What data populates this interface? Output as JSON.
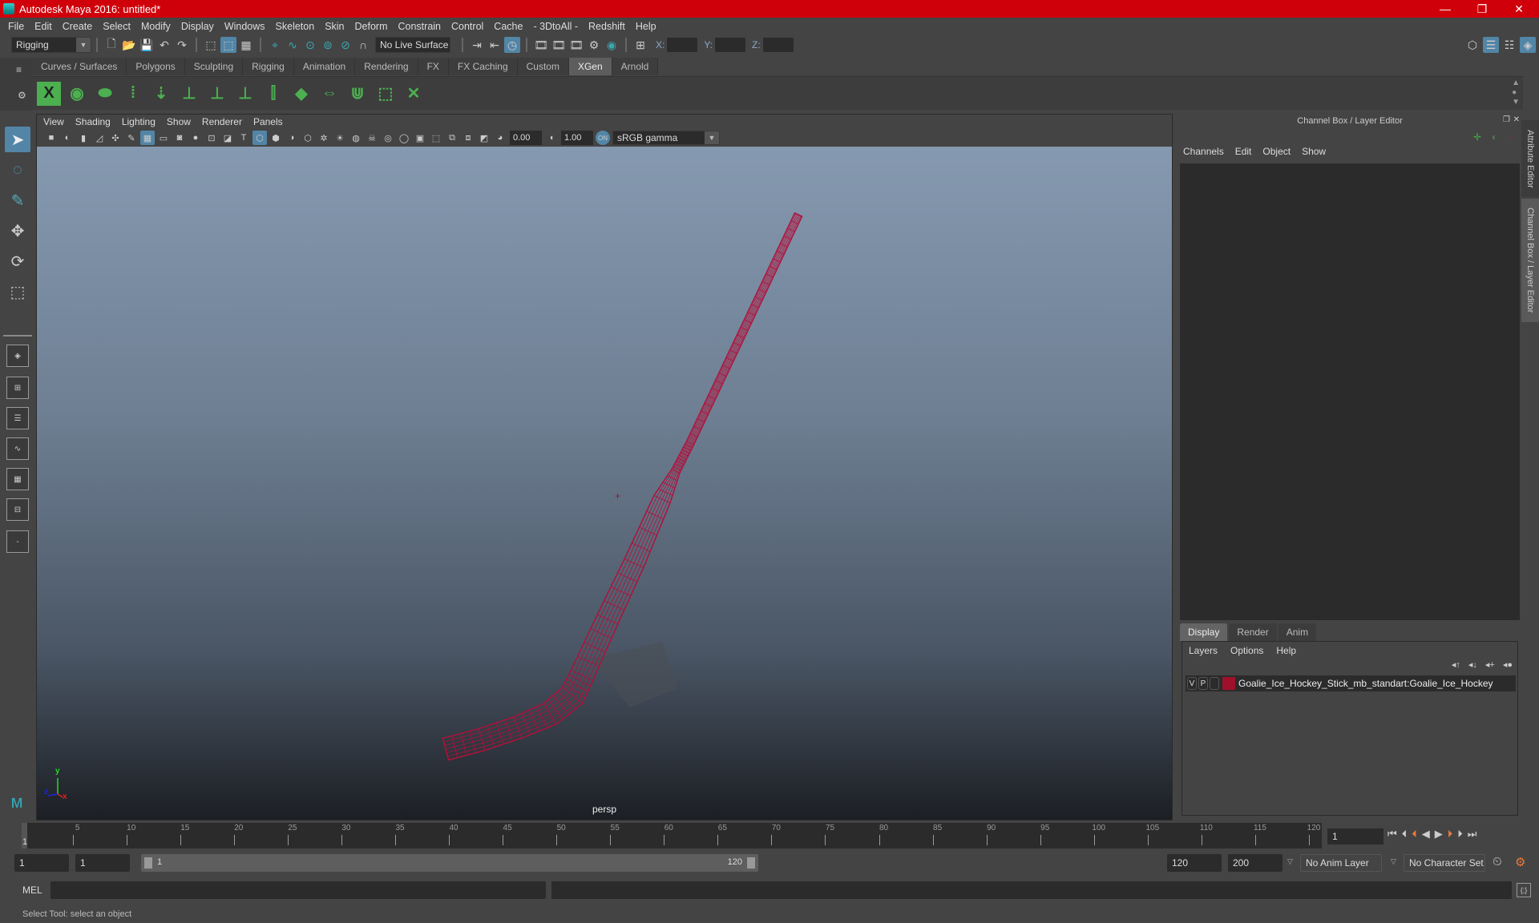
{
  "window": {
    "title": "Autodesk Maya 2016: untitled*",
    "controls": {
      "minimize": "—",
      "restore": "❐",
      "close": "✕"
    }
  },
  "menubar": [
    "File",
    "Edit",
    "Create",
    "Select",
    "Modify",
    "Display",
    "Windows",
    "Skeleton",
    "Skin",
    "Deform",
    "Constrain",
    "Control",
    "Cache",
    "- 3DtoAll -",
    "Redshift",
    "Help"
  ],
  "statusline": {
    "menuset": "Rigging",
    "live_surface": "No Live Surface",
    "coord_labels": {
      "x": "X:",
      "y": "Y:",
      "z": "Z:"
    }
  },
  "shelf": {
    "tabs": [
      "Curves / Surfaces",
      "Polygons",
      "Sculpting",
      "Rigging",
      "Animation",
      "Rendering",
      "FX",
      "FX Caching",
      "Custom",
      "XGen",
      "Arnold"
    ],
    "active_tab": "XGen",
    "icons": [
      "xgen-description-icon",
      "xgen-visibility-icon",
      "xgen-hide-icon",
      "xgen-add-guides-icon",
      "xgen-place-icon",
      "xgen-add-guide-icon",
      "xgen-show-guide-icon",
      "xgen-lock-guide-icon",
      "xgen-split-guide-icon",
      "xgen-patch-icon",
      "xgen-flip-icon",
      "xgen-select-guides-icon",
      "xgen-select-box-icon",
      "xgen-delete-guide-icon"
    ]
  },
  "viewport": {
    "menu": [
      "View",
      "Shading",
      "Lighting",
      "Show",
      "Renderer",
      "Panels"
    ],
    "exposure": "0.00",
    "gamma": "1.00",
    "color_space": "sRGB gamma",
    "camera_label": "persp",
    "axis": {
      "x": "x",
      "y": "y",
      "z": "z"
    },
    "wire_color": "#b0103a"
  },
  "right_panel": {
    "title": "Channel Box / Layer Editor",
    "menu": [
      "Channels",
      "Edit",
      "Object",
      "Show"
    ],
    "tabs": [
      "Display",
      "Render",
      "Anim"
    ],
    "active_tab": "Display",
    "layer_menu": [
      "Layers",
      "Options",
      "Help"
    ],
    "layer": {
      "v": "V",
      "p": "P",
      "color": "#a0102a",
      "name": "Goalie_Ice_Hockey_Stick_mb_standart:Goalie_Ice_Hockey"
    },
    "side_tabs": [
      "Attribute Editor",
      "Channel Box / Layer Editor"
    ]
  },
  "timeline": {
    "current_frame_marker": "1",
    "ticks": [
      5,
      10,
      15,
      20,
      25,
      30,
      35,
      40,
      45,
      50,
      55,
      60,
      65,
      70,
      75,
      80,
      85,
      90,
      95,
      100,
      105,
      110,
      115,
      120
    ],
    "start": 1,
    "end": 120,
    "current_frame": "1"
  },
  "range": {
    "start_time": "1",
    "playback_start": "1",
    "slider_start": "1",
    "slider_end": "120",
    "playback_end": "120",
    "end_time": "200",
    "anim_layer": "No Anim Layer",
    "character_set": "No Character Set"
  },
  "command_line": {
    "label": "MEL",
    "value": ""
  },
  "help_line": "Select Tool: select an object"
}
